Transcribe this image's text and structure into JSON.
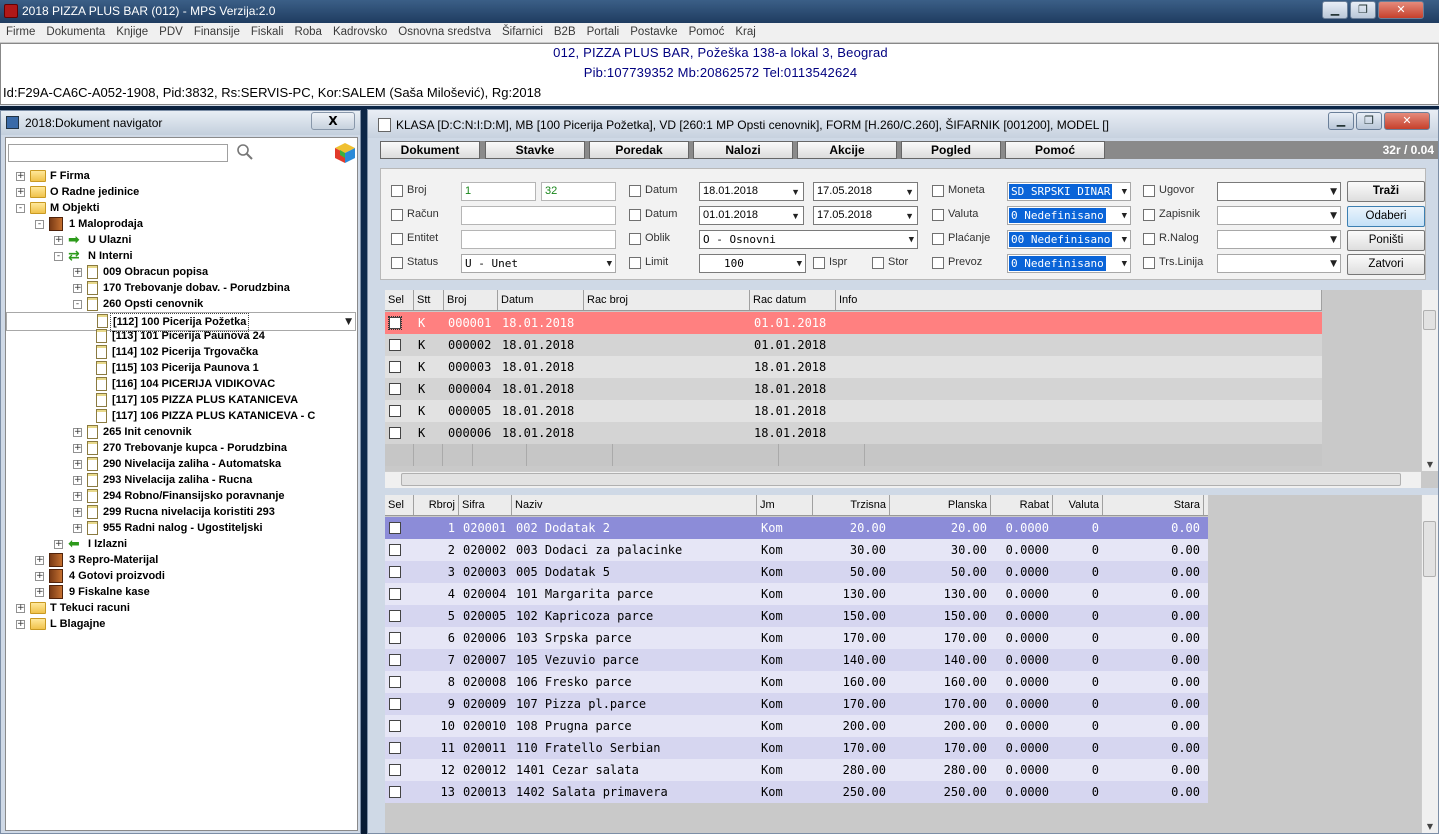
{
  "main": {
    "title": "2018 PIZZA PLUS BAR (012) - MPS Verzija:2.0",
    "menu": [
      "Firme",
      "Dokumenta",
      "Knjige",
      "PDV",
      "Finansije",
      "Fiskali",
      "Roba",
      "Kadrovsko",
      "Osnovna sredstva",
      "Šifarnici",
      "B2B",
      "Portali",
      "Postavke",
      "Pomoć",
      "Kraj"
    ],
    "header_line1": "012, PIZZA PLUS BAR, Požeška 138-a lokal 3, Beograd",
    "header_line2": "Pib:107739352 Mb:20862572 Tel:0113542624",
    "header_line3": "Id:F29A-CA6C-A052-1908, Pid:3832, Rs:SERVIS-PC, Kor:SALEM (Saša Milošević), Rg:2018"
  },
  "nav": {
    "title": "2018:Dokument navigator",
    "close_label": "X",
    "search_value": "",
    "tree": [
      {
        "label": "F Firma",
        "level": 0,
        "icon": "folder-icon",
        "exp": "+"
      },
      {
        "label": "O Radne jedinice",
        "level": 0,
        "icon": "folder-icon",
        "exp": "+"
      },
      {
        "label": "M Objekti",
        "level": 0,
        "icon": "folder-icon",
        "exp": "-"
      },
      {
        "label": "1 Maloprodaja",
        "level": 1,
        "icon": "book-icon",
        "exp": "-"
      },
      {
        "label": "U Ulazni",
        "level": 2,
        "icon": "arrow-right-icon",
        "exp": "+"
      },
      {
        "label": "N Interni",
        "level": 2,
        "icon": "transfer-icon",
        "exp": "-"
      },
      {
        "label": "009 Obracun popisa",
        "level": 3,
        "icon": "document-icon",
        "exp": "+"
      },
      {
        "label": "170 Trebovanje dobav. - Porudzbina",
        "level": 3,
        "icon": "document-icon",
        "exp": "+"
      },
      {
        "label": "260 Opsti cenovnik",
        "level": 3,
        "icon": "document-icon",
        "exp": "-"
      },
      {
        "label": "[112] 100 Picerija Požetka",
        "level": 4,
        "icon": "document-icon",
        "exp": "",
        "selected": true
      },
      {
        "label": "[113] 101 Picerija Paunova 24",
        "level": 4,
        "icon": "document-icon",
        "exp": ""
      },
      {
        "label": "[114] 102 Picerija Trgovačka",
        "level": 4,
        "icon": "document-icon",
        "exp": ""
      },
      {
        "label": "[115] 103 Picerija Paunova 1",
        "level": 4,
        "icon": "document-icon",
        "exp": ""
      },
      {
        "label": "[116] 104 PICERIJA VIDIKOVAC",
        "level": 4,
        "icon": "document-icon",
        "exp": ""
      },
      {
        "label": "[117] 105 PIZZA PLUS KATANICEVA",
        "level": 4,
        "icon": "document-icon",
        "exp": ""
      },
      {
        "label": "[117] 106 PIZZA PLUS KATANICEVA - C",
        "level": 4,
        "icon": "document-icon",
        "exp": ""
      },
      {
        "label": "265 Init cenovnik",
        "level": 3,
        "icon": "document-icon",
        "exp": "+"
      },
      {
        "label": "270 Trebovanje kupca - Porudzbina",
        "level": 3,
        "icon": "document-icon",
        "exp": "+"
      },
      {
        "label": "290 Nivelacija zaliha - Automatska",
        "level": 3,
        "icon": "document-icon",
        "exp": "+"
      },
      {
        "label": "293 Nivelacija zaliha - Rucna",
        "level": 3,
        "icon": "document-icon",
        "exp": "+"
      },
      {
        "label": "294 Robno/Finansijsko poravnanje",
        "level": 3,
        "icon": "document-icon",
        "exp": "+"
      },
      {
        "label": "299 Rucna nivelacija koristiti 293",
        "level": 3,
        "icon": "document-icon",
        "exp": "+"
      },
      {
        "label": "955 Radni nalog - Ugostiteljski",
        "level": 3,
        "icon": "document-icon",
        "exp": "+"
      },
      {
        "label": "I Izlazni",
        "level": 2,
        "icon": "arrow-left-icon",
        "exp": "+"
      },
      {
        "label": "3 Repro-Materijal",
        "level": 1,
        "icon": "book-icon",
        "exp": "+"
      },
      {
        "label": "4 Gotovi proizvodi",
        "level": 1,
        "icon": "book-icon",
        "exp": "+"
      },
      {
        "label": "9 Fiskalne kase",
        "level": 1,
        "icon": "book-icon",
        "exp": "+"
      },
      {
        "label": "T Tekuci racuni",
        "level": 0,
        "icon": "folder-icon",
        "exp": "+"
      },
      {
        "label": "L Blagajne",
        "level": 0,
        "icon": "folder-icon",
        "exp": "+"
      }
    ]
  },
  "doc": {
    "title": "KLASA [D:C:N:I:D:M], MB [100 Picerija Požetka], VD [260:1 MP Opsti cenovnik], FORM [H.260/C.260], ŠIFARNIK [001200], MODEL []",
    "toolbar": [
      "Dokument",
      "Stavke",
      "Poredak",
      "Nalozi",
      "Akcije",
      "Pogled",
      "Pomoć"
    ],
    "page_counter": "32r / 0.04",
    "filters": {
      "broj_label": "Broj",
      "broj_from": "1",
      "broj_to": "32",
      "racun_label": "Račun",
      "racun_value": "",
      "entitet_label": "Entitet",
      "entitet_value": "",
      "status_label": "Status",
      "status_value": "U - Unet",
      "datum1_label": "Datum",
      "datum1_from": "18.01.2018",
      "datum1_to": "17.05.2018",
      "datum2_label": "Datum",
      "datum2_from": "01.01.2018",
      "datum2_to": "17.05.2018",
      "oblik_label": "Oblik",
      "oblik_value": "O - Osnovni",
      "limit_label": "Limit",
      "limit_value": "100",
      "ispr_label": "Ispr",
      "stor_label": "Stor",
      "moneta_label": "Moneta",
      "moneta_value": "SD SRPSKI DINAR",
      "valuta_label": "Valuta",
      "valuta_value": "0 Nedefinisano",
      "placanje_label": "Plaćanje",
      "placanje_value": "00 Nedefinisano",
      "prevoz_label": "Prevoz",
      "prevoz_value": "0 Nedefinisano",
      "ugovor_label": "Ugovor",
      "zapisnik_label": "Zapisnik",
      "rnalog_label": "R.Nalog",
      "trslinija_label": "Trs.Linija"
    },
    "actions": [
      "Traži",
      "Odaberi",
      "Poništi",
      "Zatvori"
    ],
    "grid1": {
      "headers": [
        "Sel",
        "Stt",
        "Broj",
        "Datum",
        "Rac broj",
        "Rac datum",
        "Info"
      ],
      "rows": [
        {
          "stt": "K",
          "broj": "000001",
          "datum": "18.01.2018",
          "rac_broj": "",
          "rac_datum": "01.01.2018",
          "info": ""
        },
        {
          "stt": "K",
          "broj": "000002",
          "datum": "18.01.2018",
          "rac_broj": "",
          "rac_datum": "01.01.2018",
          "info": ""
        },
        {
          "stt": "K",
          "broj": "000003",
          "datum": "18.01.2018",
          "rac_broj": "",
          "rac_datum": "18.01.2018",
          "info": ""
        },
        {
          "stt": "K",
          "broj": "000004",
          "datum": "18.01.2018",
          "rac_broj": "",
          "rac_datum": "18.01.2018",
          "info": ""
        },
        {
          "stt": "K",
          "broj": "000005",
          "datum": "18.01.2018",
          "rac_broj": "",
          "rac_datum": "18.01.2018",
          "info": ""
        },
        {
          "stt": "K",
          "broj": "000006",
          "datum": "18.01.2018",
          "rac_broj": "",
          "rac_datum": "18.01.2018",
          "info": ""
        }
      ]
    },
    "grid2": {
      "headers": [
        "Sel",
        "Rbroj",
        "Sifra",
        "Naziv",
        "Jm",
        "Trzisna",
        "Planska",
        "Rabat",
        "Valuta",
        "Stara"
      ],
      "rows": [
        {
          "rb": "1",
          "sifra": "020001",
          "naziv": "002 Dodatak 2",
          "jm": "Kom",
          "trz": "20.00",
          "plan": "20.00",
          "rabat": "0.0000",
          "val": "0",
          "stara": "0.00"
        },
        {
          "rb": "2",
          "sifra": "020002",
          "naziv": "003 Dodaci za palacinke",
          "jm": "Kom",
          "trz": "30.00",
          "plan": "30.00",
          "rabat": "0.0000",
          "val": "0",
          "stara": "0.00"
        },
        {
          "rb": "3",
          "sifra": "020003",
          "naziv": "005 Dodatak 5",
          "jm": "Kom",
          "trz": "50.00",
          "plan": "50.00",
          "rabat": "0.0000",
          "val": "0",
          "stara": "0.00"
        },
        {
          "rb": "4",
          "sifra": "020004",
          "naziv": "101 Margarita parce",
          "jm": "Kom",
          "trz": "130.00",
          "plan": "130.00",
          "rabat": "0.0000",
          "val": "0",
          "stara": "0.00"
        },
        {
          "rb": "5",
          "sifra": "020005",
          "naziv": "102 Kapricoza parce",
          "jm": "Kom",
          "trz": "150.00",
          "plan": "150.00",
          "rabat": "0.0000",
          "val": "0",
          "stara": "0.00"
        },
        {
          "rb": "6",
          "sifra": "020006",
          "naziv": "103 Srpska parce",
          "jm": "Kom",
          "trz": "170.00",
          "plan": "170.00",
          "rabat": "0.0000",
          "val": "0",
          "stara": "0.00"
        },
        {
          "rb": "7",
          "sifra": "020007",
          "naziv": "105 Vezuvio parce",
          "jm": "Kom",
          "trz": "140.00",
          "plan": "140.00",
          "rabat": "0.0000",
          "val": "0",
          "stara": "0.00"
        },
        {
          "rb": "8",
          "sifra": "020008",
          "naziv": "106 Fresko parce",
          "jm": "Kom",
          "trz": "160.00",
          "plan": "160.00",
          "rabat": "0.0000",
          "val": "0",
          "stara": "0.00"
        },
        {
          "rb": "9",
          "sifra": "020009",
          "naziv": "107 Pizza pl.parce",
          "jm": "Kom",
          "trz": "170.00",
          "plan": "170.00",
          "rabat": "0.0000",
          "val": "0",
          "stara": "0.00"
        },
        {
          "rb": "10",
          "sifra": "020010",
          "naziv": "108 Prugna parce",
          "jm": "Kom",
          "trz": "200.00",
          "plan": "200.00",
          "rabat": "0.0000",
          "val": "0",
          "stara": "0.00"
        },
        {
          "rb": "11",
          "sifra": "020011",
          "naziv": "110 Fratello Serbian",
          "jm": "Kom",
          "trz": "170.00",
          "plan": "170.00",
          "rabat": "0.0000",
          "val": "0",
          "stara": "0.00"
        },
        {
          "rb": "12",
          "sifra": "020012",
          "naziv": "1401 Cezar salata",
          "jm": "Kom",
          "trz": "280.00",
          "plan": "280.00",
          "rabat": "0.0000",
          "val": "0",
          "stara": "0.00"
        },
        {
          "rb": "13",
          "sifra": "020013",
          "naziv": "1402 Salata primavera",
          "jm": "Kom",
          "trz": "250.00",
          "plan": "250.00",
          "rabat": "0.0000",
          "val": "0",
          "stara": "0.00"
        }
      ]
    }
  },
  "colors": {
    "selected_row1": "#ff8080",
    "grid2_row_a": "#d6d6f0",
    "grid2_row_b": "#e6e6f6",
    "grid2_selected": "#8c8cd8",
    "grid1_row_a": "#e2e2e2",
    "grid1_row_b": "#d4d4d4"
  }
}
